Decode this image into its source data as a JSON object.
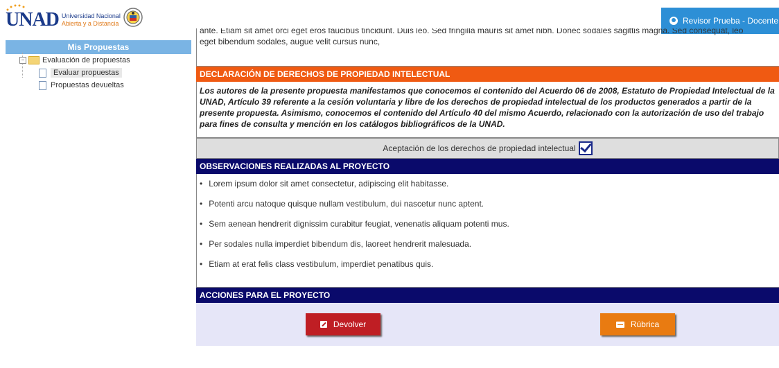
{
  "header": {
    "logo_text": "UNAD",
    "university_line1": "Universidad Nacional",
    "university_line2": "Abierta y a Distancia",
    "user_label": "Revisor Prueba - Docente"
  },
  "sidebar": {
    "title": "Mis Propuestas",
    "folder_label": "Evaluación de propuestas",
    "items": [
      {
        "label": "Evaluar propuestas"
      },
      {
        "label": "Propuestas devueltas"
      }
    ]
  },
  "intro": {
    "line1": "ante. Etiam sit amet orci eget eros faucibus tincidunt. Duis leo. Sed fringilla mauris sit amet nibh. Donec sodales sagittis magna. Sed consequat, leo",
    "line2": "eget bibendum sodales, augue velit cursus nunc,"
  },
  "declaration": {
    "title": "DECLARACIÓN DE DERECHOS DE PROPIEDAD INTELECTUAL",
    "text": "Los autores de la presente propuesta manifestamos que conocemos el contenido del Acuerdo 06 de 2008, Estatuto de Propiedad Intelectual de la UNAD, Artículo 39 referente a la cesión voluntaria y libre de los derechos de propiedad intelectual de los productos generados a partir de la presente propuesta. Asimismo, conocemos el contenido del Artículo 40 del mismo Acuerdo, relacionado con la autorización de uso del trabajo para fines de consulta y mención en los catálogos bibliográficos de la UNAD.",
    "accept_label": "Aceptación de los derechos de propiedad intelectual"
  },
  "observations": {
    "title": "OBSERVACIONES REALIZADAS AL PROYECTO",
    "items": [
      "Lorem ipsum dolor sit amet consectetur, adipiscing elit habitasse.",
      "Potenti arcu natoque quisque nullam vestibulum, dui nascetur nunc aptent.",
      "Sem aenean hendrerit dignissim curabitur feugiat, venenatis aliquam potenti mus.",
      "Per sodales nulla imperdiet bibendum dis, laoreet hendrerit malesuada.",
      "Etiam at erat felis class vestibulum, imperdiet penatibus quis."
    ]
  },
  "actions": {
    "title": "ACCIONES PARA EL PROYECTO",
    "return_label": "Devolver",
    "rubric_label": "Rúbrica"
  },
  "colors": {
    "orange_header": "#f05a12",
    "navy_header": "#0a0a6b",
    "user_button": "#2d8fd6",
    "return_button": "#bf1e24",
    "rubric_button": "#e97b11"
  }
}
